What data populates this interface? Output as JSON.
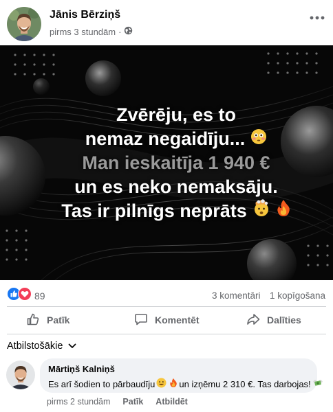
{
  "post": {
    "author_name": "Jānis Bērziņš",
    "time": "pirms 3 stundām",
    "separator": "·",
    "image_text": {
      "line1": "Zvērēju, es to",
      "line2": "nemaz negaidīju...",
      "line3": "Man ieskaitīja 1 940 €",
      "line4": "un es neko nemaksāju.",
      "line5": "Tas ir pilnīgs neprāts"
    }
  },
  "stats": {
    "reactions_count": "89",
    "comments": "3 komentāri",
    "shares": "1 kopīgošana"
  },
  "actions": {
    "like": "Patīk",
    "comment": "Komentēt",
    "share": "Dalīties"
  },
  "comments_filter": "Atbilstošākie",
  "comment": {
    "author": "Mārtiņš Kalniņš",
    "text_part1": "Es arī šodien to pārbaudīju",
    "text_part2": "un izņēmu 2 310 €. Tas darbojas!",
    "time": "pirms 2 stundām",
    "like": "Patīk",
    "reply": "Atbildēt"
  },
  "icons": {
    "privacy": "globe-icon",
    "more": "more-dots-icon",
    "like_reaction": "like-reaction-icon",
    "love_reaction": "love-reaction-icon",
    "like_action": "thumbs-up-icon",
    "comment_action": "comment-bubble-icon",
    "share_action": "share-arrow-icon",
    "dropdown": "chevron-down-icon"
  },
  "colors": {
    "facebook_blue": "#1877f2",
    "love_red": "#f33e58",
    "secondary_text": "#65676b",
    "bubble_bg": "#f0f2f5"
  }
}
